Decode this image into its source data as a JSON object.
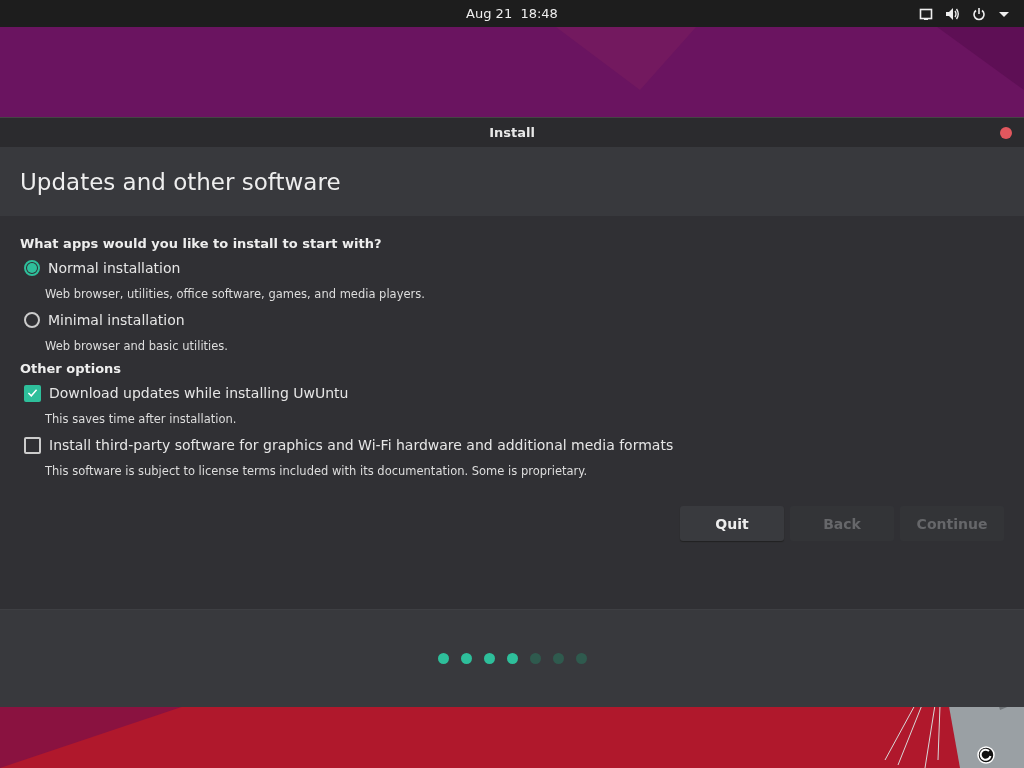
{
  "top_bar": {
    "clock": "Aug 21  18:48"
  },
  "window": {
    "title": "Install",
    "heading": "Updates and other software"
  },
  "sections": [
    {
      "title": "What apps would you like to install to start with?",
      "options": [
        {
          "kind": "radio",
          "label": "Normal installation",
          "description": "Web browser, utilities, office software, games, and media players.",
          "selected": true
        },
        {
          "kind": "radio",
          "label": "Minimal installation",
          "description": "Web browser and basic utilities.",
          "selected": false
        }
      ]
    },
    {
      "title": "Other options",
      "options": [
        {
          "kind": "checkbox",
          "label": "Download updates while installing UwUntu",
          "description": "This saves time after installation.",
          "checked": true
        },
        {
          "kind": "checkbox",
          "label": "Install third-party software for graphics and Wi-Fi hardware and additional media formats",
          "description": "This software is subject to license terms included with its documentation. Some is proprietary.",
          "checked": false
        }
      ]
    }
  ],
  "buttons": [
    {
      "label": "Quit",
      "disabled": false
    },
    {
      "label": "Back",
      "disabled": true
    },
    {
      "label": "Continue",
      "disabled": true
    }
  ],
  "progress": [
    {
      "done": true
    },
    {
      "done": true
    },
    {
      "done": true
    },
    {
      "done": true
    },
    {
      "done": false
    },
    {
      "done": false
    },
    {
      "done": false
    }
  ]
}
